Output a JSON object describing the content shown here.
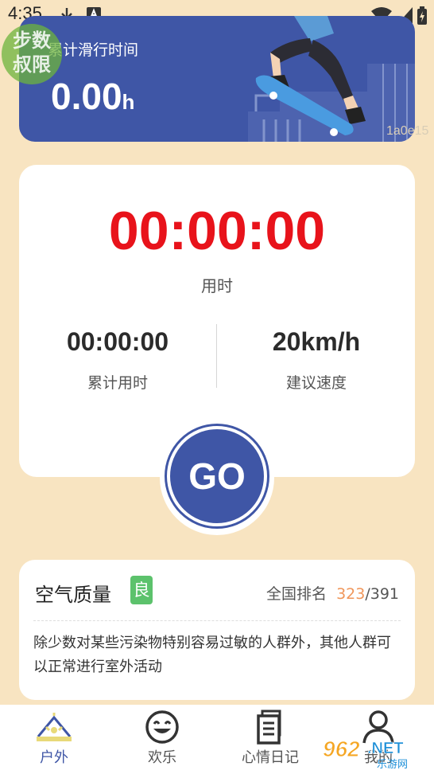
{
  "status_bar": {
    "time": "4:35"
  },
  "watermark": {
    "badge_line1": "步数",
    "badge_line2": "叔限",
    "code": "1a0e15"
  },
  "banner": {
    "label": "累计滑行时间",
    "value": "0.00",
    "unit": "h"
  },
  "timer": {
    "main": "00:00:00",
    "caption": "用时",
    "stats": [
      {
        "value": "00:00:00",
        "label": "累计用时"
      },
      {
        "value": "20km/h",
        "label": "建议速度"
      }
    ],
    "go_label": "GO"
  },
  "air": {
    "title": "空气质量",
    "badge": "良",
    "rank_label": "全国排名",
    "rank_value": "323",
    "rank_total": "/391",
    "description": "除少数对某些污染物特别容易过敏的人群外，其他人群可以正常进行室外活动"
  },
  "tabs": [
    {
      "label": "户外",
      "icon": "outdoor-icon",
      "active": true
    },
    {
      "label": "欢乐",
      "icon": "smile-icon",
      "active": false
    },
    {
      "label": "心情日记",
      "icon": "diary-icon",
      "active": false
    },
    {
      "label": "我的",
      "icon": "profile-icon",
      "active": false
    }
  ],
  "brand_watermark": "962.NET",
  "brand_watermark_sub": "乐游网",
  "colors": {
    "background": "#f8e4c1",
    "primary": "#3f56a6",
    "timer_red": "#e8131b",
    "badge_green": "#5cc26c",
    "rank_orange": "#f0965a"
  }
}
